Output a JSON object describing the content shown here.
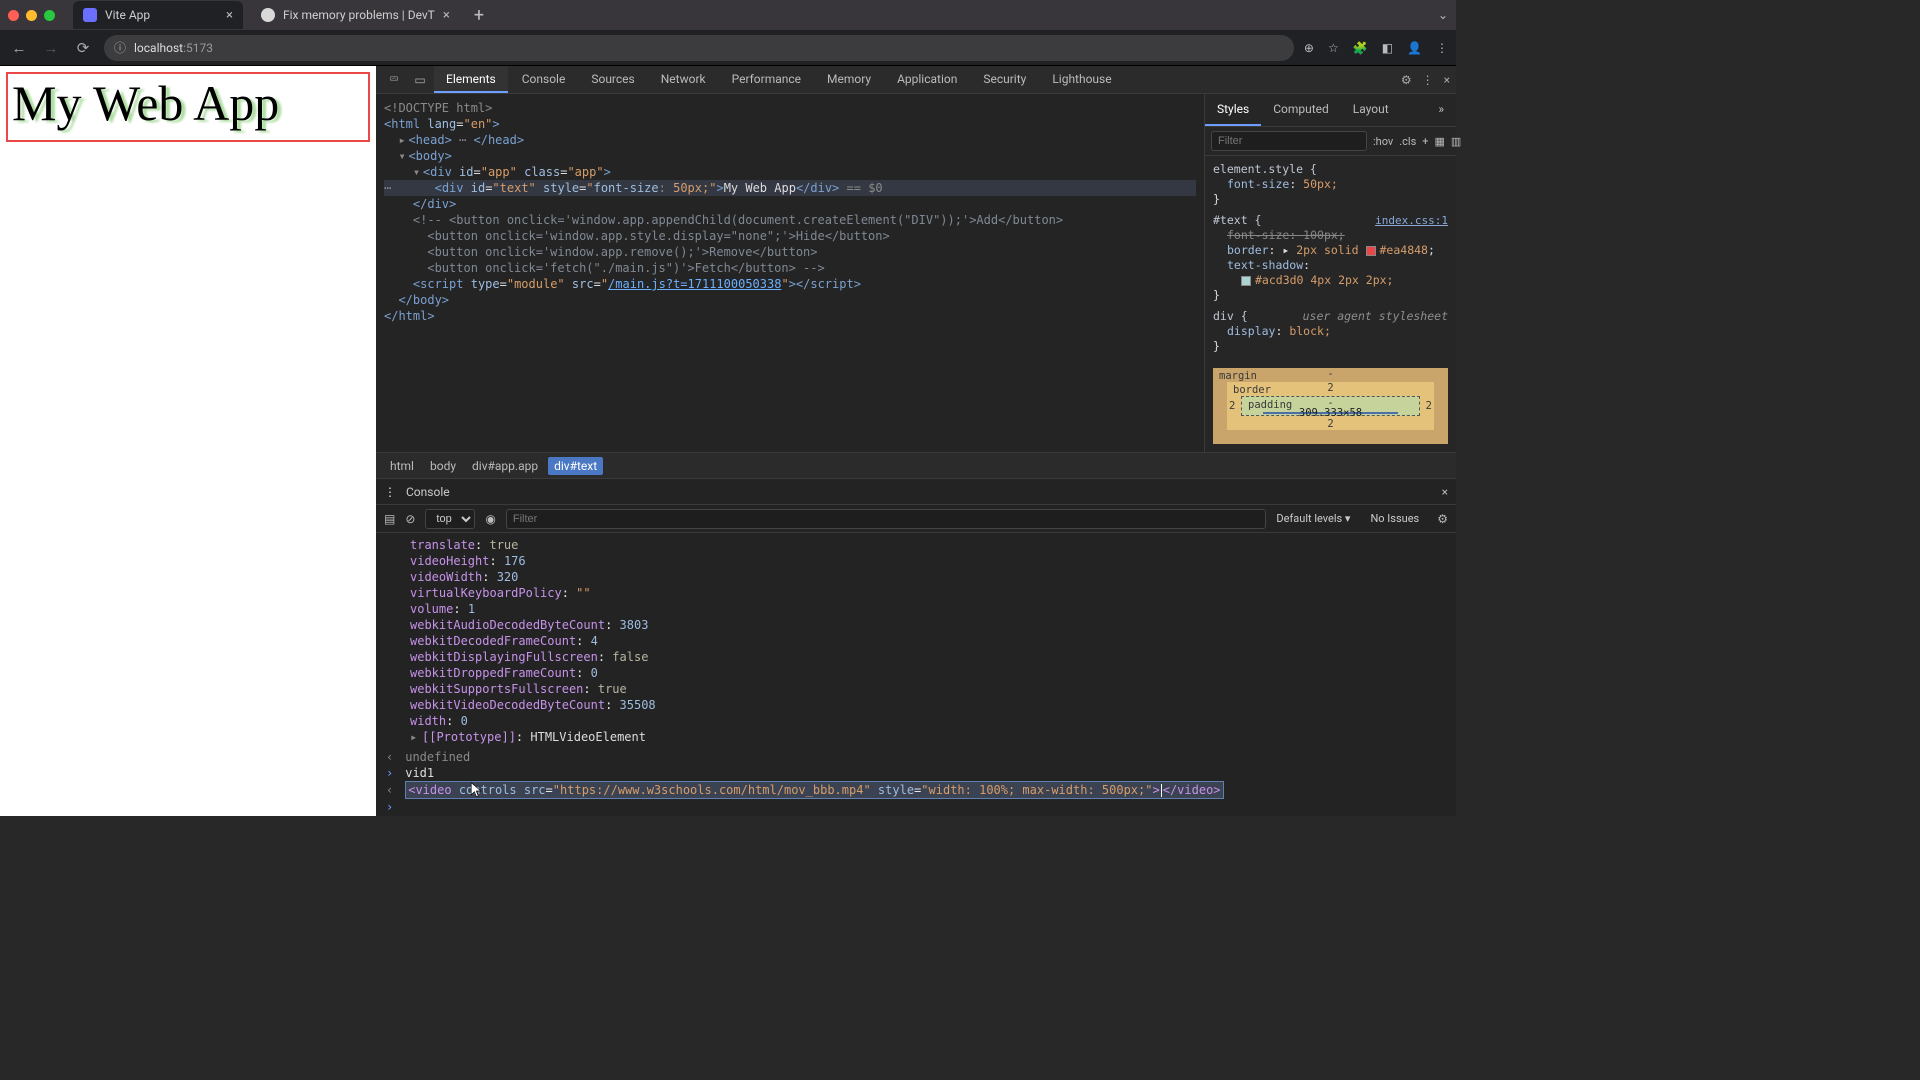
{
  "chrome": {
    "tabs": [
      {
        "title": "Vite App"
      },
      {
        "title": "Fix memory problems | DevT"
      }
    ],
    "url_host": "localhost",
    "url_path": ":5173"
  },
  "page": {
    "heading": "My Web App"
  },
  "devtools": {
    "tabs": [
      "Elements",
      "Console",
      "Sources",
      "Network",
      "Performance",
      "Memory",
      "Application",
      "Security",
      "Lighthouse"
    ],
    "active_tab": "Elements",
    "crumbs": [
      "html",
      "body",
      "div#app.app",
      "div#text"
    ],
    "active_crumb": "div#text",
    "elements": {
      "doctype": "<!DOCTYPE html>",
      "html_open": "<html lang=\"en\">",
      "head": "<head>…</head>",
      "body_open": "<body>",
      "app_open": "<div id=\"app\" class=\"app\">",
      "text_div_open": "<div id=\"text\" style=\"font-size: 50px;\">",
      "text_div_text": "My Web App",
      "text_div_close": "</div>",
      "sel_suffix": " == $0",
      "div_close": "</div>",
      "comment_open": "<!-- <button onclick='window.app.appendChild(document.createElement(\"DIV\"));'>Add</button>",
      "comment_line2": "<button onclick='window.app.style.display=\"none\";'>Hide</button>",
      "comment_line3": "<button onclick='window.app.remove();'>Remove</button>",
      "comment_line4": "<button onclick='fetch(\"./main.js\")'>Fetch</button> -->",
      "script_line": "<script type=\"module\" src=\"/main.js?t=1711100050338\"></script>",
      "body_close": "</body>",
      "html_close": "</html>"
    }
  },
  "styles": {
    "tabs": [
      "Styles",
      "Computed",
      "Layout"
    ],
    "filter_placeholder": "Filter",
    "hov": ":hov",
    "cls": ".cls",
    "element_style": "element.style {",
    "element_style_prop": "font-size",
    "element_style_val": "50px;",
    "rule_text": "#text {",
    "rule_text_src": "index.css:1",
    "rule_text_p1_k": "font-size",
    "rule_text_p1_v": "100px;",
    "rule_text_p2_k": "border",
    "rule_text_p2_v": "2px solid",
    "rule_text_p2_color": "#ea4848",
    "rule_text_p3_k": "text-shadow",
    "rule_text_p3_v": "#acd3d0 4px 2px 2px;",
    "rule_div": "div {",
    "ua_label": "user agent stylesheet",
    "rule_div_p1_k": "display",
    "rule_div_p1_v": "block;"
  },
  "boxmodel": {
    "margin": "-",
    "border": "2",
    "padding": "-",
    "content": "309.333×58"
  },
  "drawer": {
    "tab": "Console",
    "top": "top",
    "filter_placeholder": "Filter",
    "levels": "Default levels ▾",
    "issues": "No Issues",
    "props": [
      {
        "k": "translate",
        "v": "true",
        "t": "kw"
      },
      {
        "k": "videoHeight",
        "v": "176",
        "t": "num"
      },
      {
        "k": "videoWidth",
        "v": "320",
        "t": "num"
      },
      {
        "k": "virtualKeyboardPolicy",
        "v": "\"\"",
        "t": "str"
      },
      {
        "k": "volume",
        "v": "1",
        "t": "num"
      },
      {
        "k": "webkitAudioDecodedByteCount",
        "v": "3803",
        "t": "num"
      },
      {
        "k": "webkitDecodedFrameCount",
        "v": "4",
        "t": "num"
      },
      {
        "k": "webkitDisplayingFullscreen",
        "v": "false",
        "t": "kw"
      },
      {
        "k": "webkitDroppedFrameCount",
        "v": "0",
        "t": "num"
      },
      {
        "k": "webkitSupportsFullscreen",
        "v": "true",
        "t": "kw"
      },
      {
        "k": "webkitVideoDecodedByteCount",
        "v": "35508",
        "t": "num"
      },
      {
        "k": "width",
        "v": "0",
        "t": "num"
      }
    ],
    "proto_label": "[[Prototype]]",
    "proto_value": "HTMLVideoElement",
    "undefined": "undefined",
    "vid1": "vid1",
    "video_html_a": "<video controls src=\"",
    "video_html_src": "https://www.w3schools.com/html/mov_bbb.mp4",
    "video_html_b": "\" style=\"",
    "video_html_style": "width: 100%; max-width: 500px;",
    "video_html_c": "\">",
    "video_html_close": "</video>"
  }
}
